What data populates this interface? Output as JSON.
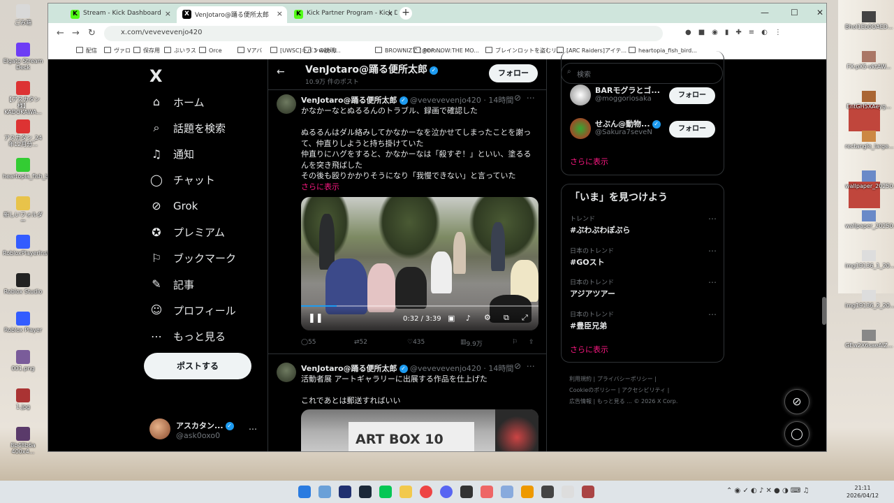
{
  "desktop": {
    "left_icons": [
      {
        "label": "ごみ箱",
        "color": "#d9d9d9"
      },
      {
        "label": "Elgato Stream Deck",
        "color": "#6d3df5"
      },
      {
        "label": "【アスカタン様】KADOKAWA...",
        "color": "#d33"
      },
      {
        "label": "アスカタン_24年12月分...",
        "color": "#d33"
      },
      {
        "label": "heartopia_fish_b...",
        "color": "#3c3"
      },
      {
        "label": "新しいフォルダー",
        "color": "#e8c34a"
      },
      {
        "label": "RobloxPlayerInst...",
        "color": "#335cff"
      },
      {
        "label": "Roblox Studio",
        "color": "#222"
      },
      {
        "label": "Roblox Player",
        "color": "#335cff"
      },
      {
        "label": "001.png",
        "color": "#7a5c9a"
      },
      {
        "label": "1.jpg",
        "color": "#a33"
      },
      {
        "label": "8b48b6a 400x4...",
        "color": "#5a3a6a"
      }
    ],
    "right_icons": [
      {
        "label": "Bhol1Eb0OAED...",
        "color": "#444"
      },
      {
        "label": "FX-pX5-vktAW...",
        "color": "#a76"
      },
      {
        "label": "EntGH5XAeyg...",
        "color": "#a63"
      },
      {
        "label": "rectangle_large...",
        "color": "#c84"
      },
      {
        "label": "wallpaper_20250...",
        "color": "#6a8ac8"
      },
      {
        "label": "wallpaper_20250...",
        "color": "#6a8ac8"
      },
      {
        "label": "img19136_1_20...",
        "color": "#ddd"
      },
      {
        "label": "img19136_2_20...",
        "color": "#ddd"
      },
      {
        "label": "GEw2X6saeAIZ...",
        "color": "#888"
      }
    ]
  },
  "browser": {
    "tabs": [
      {
        "title": "Stream - Kick Dashboard",
        "favicon": "K",
        "active": false
      },
      {
        "title": "VenJotaro@踊る便所太郎",
        "favicon": "X",
        "active": true
      },
      {
        "title": "Kick Partner Program - Kick Da...",
        "favicon": "K",
        "active": false
      }
    ],
    "url": "x.com/vevevevenjo420",
    "bookmarks": [
      "配信",
      "ヴァロ",
      "保存用",
      "ぶいラス",
      "Orce",
      "Vアバ",
      "[UWSC]キパンの説明...",
      "3 with U",
      "BROWNIZで (@bro...",
      "POP NOW:THE MO...",
      "ブレインロットを盗むリ...",
      "[ARC Raiders]アイテ...",
      "heartopia_fish_bird..."
    ]
  },
  "sidebar": {
    "logo": "X",
    "items": [
      {
        "label": "ホーム",
        "icon": "home-icon",
        "glyph": "⌂"
      },
      {
        "label": "話題を検索",
        "icon": "search-icon",
        "glyph": "⌕"
      },
      {
        "label": "通知",
        "icon": "bell-icon",
        "glyph": "♫"
      },
      {
        "label": "チャット",
        "icon": "chat-icon",
        "glyph": "◯"
      },
      {
        "label": "Grok",
        "icon": "grok-icon",
        "glyph": "⊘"
      },
      {
        "label": "プレミアム",
        "icon": "premium-icon",
        "glyph": "✪"
      },
      {
        "label": "ブックマーク",
        "icon": "bookmark-icon",
        "glyph": "⚐"
      },
      {
        "label": "記事",
        "icon": "article-icon",
        "glyph": "✎"
      },
      {
        "label": "プロフィール",
        "icon": "profile-icon",
        "glyph": "☺"
      },
      {
        "label": "もっと見る",
        "icon": "more-icon",
        "glyph": "⋯"
      }
    ],
    "post_button": "ポストする",
    "account": {
      "name": "アスカタン...",
      "handle": "@ask0oxo0"
    }
  },
  "profile_header": {
    "name": "VenJotaro@踊る便所太郎",
    "post_count": "10.9万 件のポスト",
    "follow_label": "フォロー"
  },
  "tweets": [
    {
      "name": "VenJotaro@踊る便所太郎",
      "handle": "@vevevevenjo420",
      "time": "14時間",
      "text": "かなかーなとぬるるんのトラブル、録画で確認した\n\nぬるるんはダル絡みしてかなかーなを泣かせてしまったことを謝って、仲直りしようと持ち掛けていた\n仲直りにハグをすると、かなかーなは「殺すぞ！」といい、塗るるんを突き飛ばした\nその後も殴りかかりそうになり「我慢できない」と言っていた",
      "show_more": "さらに表示",
      "video_time": "0:32 / 3:39",
      "video_progress": 0.15,
      "replies": "55",
      "reposts": "52",
      "likes": "435",
      "views": "9.9万"
    },
    {
      "name": "VenJotaro@踊る便所太郎",
      "handle": "@vevevevenjo420",
      "time": "14時間",
      "text": "活動者展 アートギャラリーに出展する作品を仕上げた\n\nこれであとは郵送すればいい",
      "image_text": "ART BOX 10"
    }
  ],
  "right": {
    "search_placeholder": "検索",
    "who_to_follow": [
      {
        "name": "BARモグラとゴ...",
        "handle": "@moggoriosaka",
        "follow": "フォロー"
      },
      {
        "name": "せぶん@動物...",
        "handle": "@Sakura7seveN",
        "follow": "フォロー"
      }
    ],
    "show_more": "さらに表示",
    "trends_title": "「いま」を見つけよう",
    "trends": [
      {
        "context": "トレンド",
        "tag": "#ぷわぷわぽぷら"
      },
      {
        "context": "日本のトレンド",
        "tag": "#GOスト"
      },
      {
        "context": "日本のトレンド",
        "tag": "アジアツアー"
      },
      {
        "context": "日本のトレンド",
        "tag": "#豊臣兄弟"
      }
    ],
    "trends_more": "さらに表示",
    "footer": [
      "利用規約",
      "プライバシーポリシー",
      "Cookieのポリシー",
      "アクセシビリティ",
      "広告情報",
      "もっと見る ...",
      "© 2026 X Corp."
    ]
  },
  "taskbar": {
    "time": "21:11",
    "date": "2026/04/12"
  }
}
